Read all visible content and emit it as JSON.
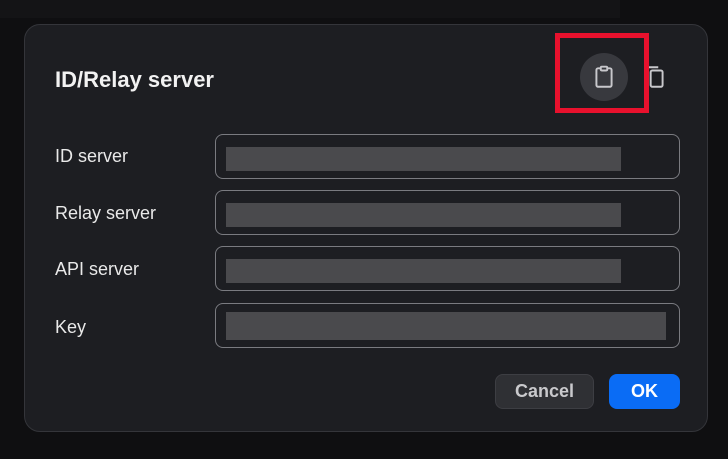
{
  "dialog": {
    "title": "ID/Relay server",
    "fields": [
      {
        "label": "ID server",
        "value": ""
      },
      {
        "label": "Relay server",
        "value": ""
      },
      {
        "label": "API server",
        "value": ""
      },
      {
        "label": "Key",
        "value": ""
      }
    ],
    "icons": {
      "paste": "clipboard-paste-icon",
      "copy": "copy-icon"
    },
    "buttons": {
      "cancel": "Cancel",
      "ok": "OK"
    },
    "colors": {
      "accent": "#0a6cf5",
      "highlight": "#e8112d",
      "surface": "#1d1e22"
    }
  }
}
